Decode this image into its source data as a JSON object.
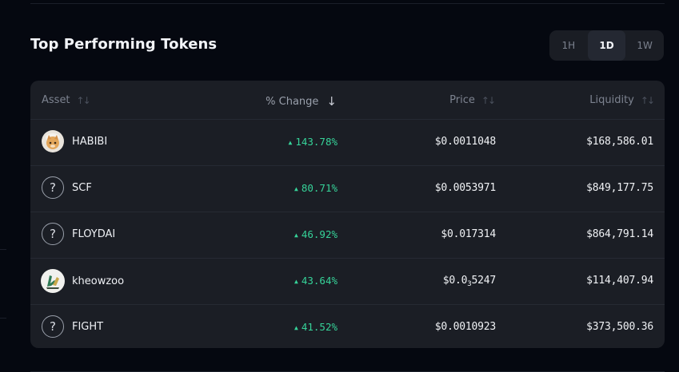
{
  "section": {
    "title": "Top Performing Tokens",
    "range_options": [
      "1H",
      "1D",
      "1W"
    ],
    "range_selected": "1D"
  },
  "table": {
    "columns": {
      "asset": "Asset",
      "change": "% Change",
      "price": "Price",
      "liquidity": "Liquidity"
    },
    "sorted_by": "change",
    "rows": [
      {
        "name": "HABIBI",
        "icon": "cat-avatar-icon",
        "change": "143.78%",
        "price": "$0.0011048",
        "price_sub": "",
        "price_tail": "",
        "liquidity": "$168,586.01"
      },
      {
        "name": "SCF",
        "icon": "question-icon",
        "change": "80.71%",
        "price": "$0.0053971",
        "price_sub": "",
        "price_tail": "",
        "liquidity": "$849,177.75"
      },
      {
        "name": "FLOYDAI",
        "icon": "question-icon",
        "change": "46.92%",
        "price": "$0.017314",
        "price_sub": "",
        "price_tail": "",
        "liquidity": "$864,791.14"
      },
      {
        "name": "kheowzoo",
        "icon": "zoo-logo-icon",
        "change": "43.64%",
        "price": "$0.0",
        "price_sub": "3",
        "price_tail": "5247",
        "liquidity": "$114,407.94"
      },
      {
        "name": "FIGHT",
        "icon": "question-icon",
        "change": "41.52%",
        "price": "$0.0010923",
        "price_sub": "",
        "price_tail": "",
        "liquidity": "$373,500.36"
      }
    ],
    "colors": {
      "positive": "#36d399"
    }
  }
}
